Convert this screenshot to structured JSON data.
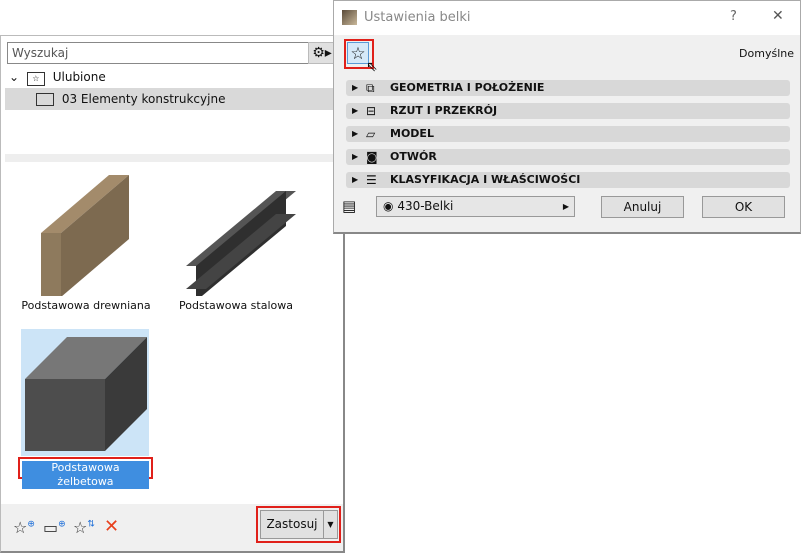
{
  "dialog": {
    "title": "Ustawienia belki",
    "help": "?",
    "close": "✕",
    "default_label": "Domyślne",
    "sections": [
      {
        "label": "GEOMETRIA I POŁOŻENIE",
        "icon": "geometry-icon"
      },
      {
        "label": "RZUT I PRZEKRÓJ",
        "icon": "floor-plan-section-icon"
      },
      {
        "label": "MODEL",
        "icon": "model-icon"
      },
      {
        "label": "OTWÓR",
        "icon": "opening-icon"
      },
      {
        "label": "KLASYFIKACJA I WŁAŚCIWOŚCI",
        "icon": "classification-icon"
      }
    ],
    "layer": "430-Belki",
    "cancel": "Anuluj",
    "ok": "OK"
  },
  "panel": {
    "search_placeholder": "Wyszukaj",
    "tree": {
      "root": "Ulubione",
      "child": "03 Elementy konstrukcyjne"
    },
    "items": [
      {
        "label": "Podstawowa drewniana",
        "color": "#8b7357"
      },
      {
        "label": "Podstawowa stalowa",
        "color": "#3a3a3a"
      },
      {
        "label": "Podstawowa żelbetowa",
        "color": "#555555",
        "selected": true
      }
    ],
    "apply": "Zastosuj"
  }
}
